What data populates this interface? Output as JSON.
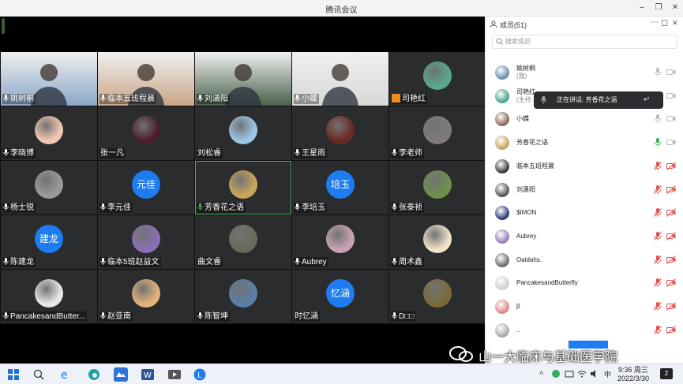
{
  "window": {
    "title": "腾讯会议"
  },
  "members_panel": {
    "title": "成员(51)",
    "search_placeholder": "搜索成员",
    "members": [
      {
        "name": "姚树桐",
        "sub": "(我)",
        "mic": "on"
      },
      {
        "name": "司艳红",
        "sub": "(主持...",
        "mic": "on"
      },
      {
        "name": "小蝶",
        "sub": "",
        "mic": "on"
      },
      {
        "name": "芳香花之语",
        "sub": "",
        "mic": "speaking"
      },
      {
        "name": "临本五班程晨",
        "sub": "",
        "mic": "muted"
      },
      {
        "name": "刘潇阳",
        "sub": "",
        "mic": "muted"
      },
      {
        "name": "$IMON",
        "sub": "",
        "mic": "muted"
      },
      {
        "name": "Aubrey",
        "sub": "",
        "mic": "muted"
      },
      {
        "name": "Oaidahs.",
        "sub": "",
        "mic": "muted"
      },
      {
        "name": "PancakesandButterfly",
        "sub": "",
        "mic": "muted"
      },
      {
        "name": "β",
        "sub": "",
        "mic": "muted"
      },
      {
        "name": "..",
        "sub": "",
        "mic": "muted"
      }
    ]
  },
  "speaking_toast": {
    "text": "正在讲话: 芳香花之语"
  },
  "gallery": [
    [
      {
        "name": "姚树桐",
        "kind": "video",
        "color": "#8aa7c9"
      },
      {
        "name": "临本五班程晨",
        "kind": "video",
        "color": "#c9a687"
      },
      {
        "name": "刘潇阳",
        "kind": "video",
        "color": "#48604a"
      },
      {
        "name": "小蝶",
        "kind": "video",
        "color": "#d8d8d8"
      },
      {
        "name": "司艳红",
        "kind": "avatar",
        "color": "#57a88f",
        "host": true
      }
    ],
    [
      {
        "name": "李晓博",
        "kind": "avatar",
        "color": "#f3c7b0"
      },
      {
        "name": "张一凡",
        "kind": "avatar",
        "color": "#4b1e2a",
        "nomic": true
      },
      {
        "name": "刘松睿",
        "kind": "avatar",
        "color": "#9cc7e8",
        "nomic": true
      },
      {
        "name": "王星雨",
        "kind": "avatar",
        "color": "#6a2a24"
      },
      {
        "name": "李老师",
        "kind": "avatar",
        "color": "#7f7a78"
      }
    ],
    [
      {
        "name": "杨士锐",
        "kind": "avatar",
        "color": "#9a9a9a"
      },
      {
        "name": "李元佳",
        "kind": "text",
        "text": "元佳"
      },
      {
        "name": "芳香花之语",
        "kind": "avatar",
        "color": "#c8a55a",
        "speaking": true
      },
      {
        "name": "李培玉",
        "kind": "text",
        "text": "培玉"
      },
      {
        "name": "张泰祯",
        "kind": "avatar",
        "color": "#6f8f4a"
      }
    ],
    [
      {
        "name": "陈建龙",
        "kind": "text",
        "text": "建龙"
      },
      {
        "name": "临本5班赵益文",
        "kind": "avatar",
        "color": "#8a6fb5"
      },
      {
        "name": "曲文睿",
        "kind": "avatar",
        "color": "#6a6a5a",
        "nomic": true
      },
      {
        "name": "Aubrey",
        "kind": "avatar",
        "color": "#c9a3b5"
      },
      {
        "name": "周术鑫",
        "kind": "avatar",
        "color": "#f1e3c8"
      }
    ],
    [
      {
        "name": "PancakesandButter...",
        "kind": "avatar",
        "color": "#e8e8e8"
      },
      {
        "name": "赵亚南",
        "kind": "avatar",
        "color": "#e3b37a"
      },
      {
        "name": "陈智坤",
        "kind": "avatar",
        "color": "#5a7fa6"
      },
      {
        "name": "时忆涵",
        "kind": "text",
        "text": "忆涵",
        "nomic": true
      },
      {
        "name": "D□□",
        "kind": "avatar",
        "color": "#7a6a3a"
      }
    ]
  ],
  "taskbar": {
    "time": "9:36 周三",
    "date": "2022/3/30",
    "ime": "中",
    "notifications": "2"
  },
  "watermark": {
    "text": "山一大临床与基础医学院"
  },
  "colors": {
    "accent": "#1e7cf2",
    "speaking": "#3fb15a",
    "muted": "#e05050"
  }
}
